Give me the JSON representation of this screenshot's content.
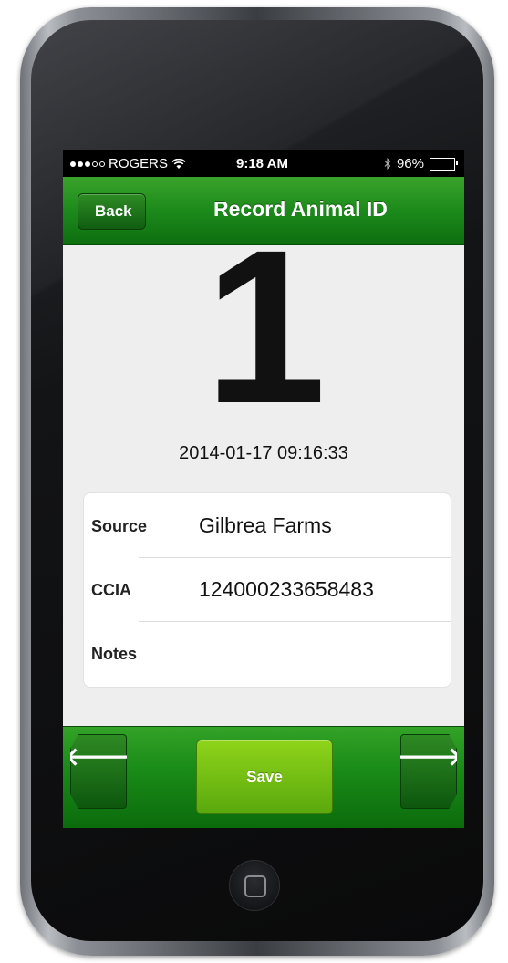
{
  "status_bar": {
    "carrier": "ROGERS",
    "time": "9:18 AM",
    "battery": "96%",
    "battery_level": 0.96,
    "signal_bars_filled": 3,
    "signal_bars_total": 5
  },
  "nav": {
    "back_label": "Back",
    "title": "Record Animal ID"
  },
  "record": {
    "number": "1",
    "timestamp": "2014-01-17 09:16:33"
  },
  "form": {
    "rows": [
      {
        "label": "Source",
        "value": "Gilbrea Farms"
      },
      {
        "label": "CCIA",
        "value": "124000233658483"
      },
      {
        "label": "Notes",
        "value": ""
      }
    ]
  },
  "toolbar": {
    "prev_glyph": "🡐",
    "save_label": "Save",
    "next_glyph": "🡒"
  },
  "colors": {
    "nav_green": "#1c8a1b",
    "save_green": "#7cc417"
  }
}
